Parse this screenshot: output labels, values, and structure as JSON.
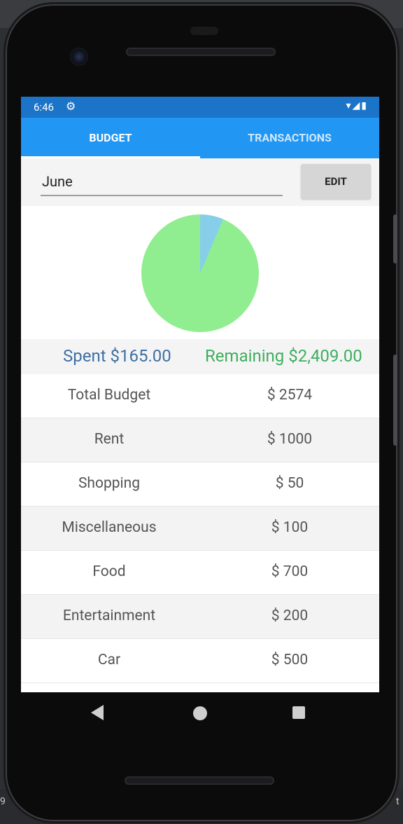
{
  "status_bar": {
    "time": "6:46",
    "settings_icon": "gear-icon",
    "right_icons": "wifi-icon signal-icon battery-icon"
  },
  "tabs": [
    {
      "label": "BUDGET",
      "active": true
    },
    {
      "label": "TRANSACTIONS",
      "active": false
    }
  ],
  "month": {
    "value": "June"
  },
  "edit_button": {
    "label": "EDIT"
  },
  "pie": {
    "spent_fraction": 0.064,
    "spent_color": "#87ceeb",
    "remaining_color": "#90ee90"
  },
  "summary": {
    "spent": "Spent $165.00",
    "remaining": "Remaining $2,409.00"
  },
  "budget_rows": [
    {
      "category": "Total Budget",
      "amount": "$ 2574"
    },
    {
      "category": "Rent",
      "amount": "$ 1000"
    },
    {
      "category": "Shopping",
      "amount": "$ 50"
    },
    {
      "category": "Miscellaneous",
      "amount": "$ 100"
    },
    {
      "category": "Food",
      "amount": "$ 700"
    },
    {
      "category": "Entertainment",
      "amount": "$ 200"
    },
    {
      "category": "Car",
      "amount": "$ 500"
    }
  ],
  "nav": {
    "back_icon": "back-icon",
    "home_icon": "home-icon",
    "recents_icon": "recents-icon"
  },
  "desktop": {
    "left_fragment": "9",
    "right_fragment": "t"
  }
}
